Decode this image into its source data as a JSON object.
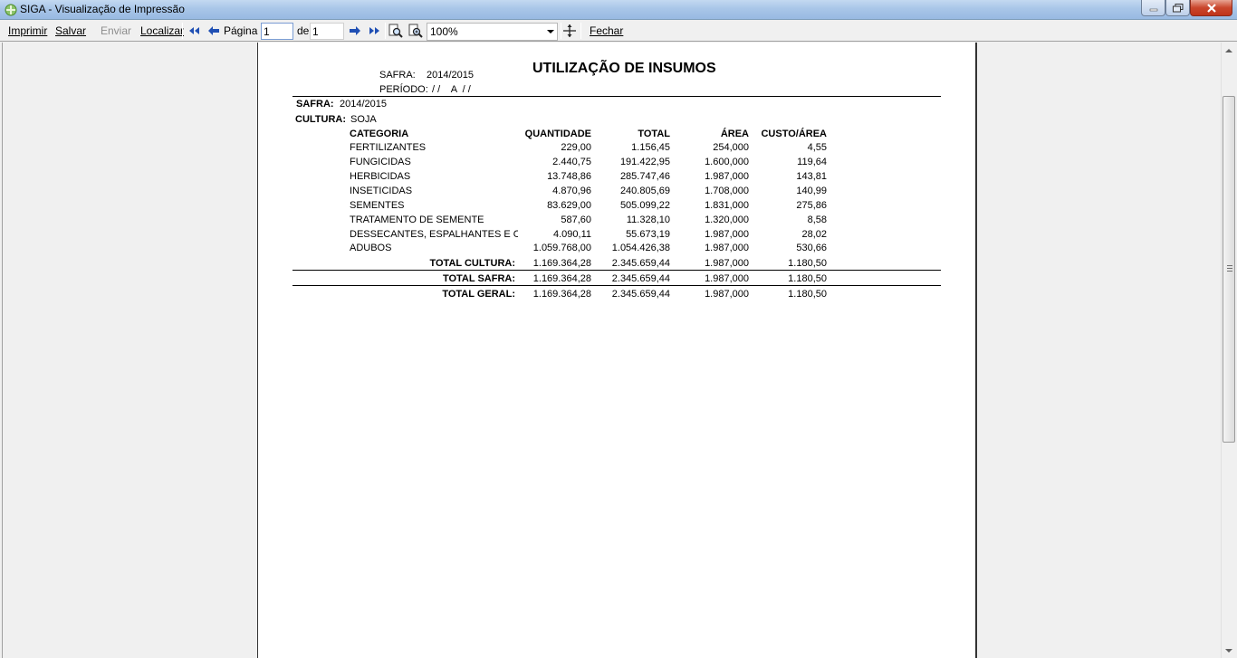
{
  "window": {
    "title": "SIGA - Visualização de Impressão"
  },
  "toolbar": {
    "imprimir": "Imprimir",
    "salvar": "Salvar",
    "enviar": "Enviar",
    "localizar": "Localizar",
    "pagina_label": "Página",
    "pagina_value": "1",
    "de_label": "de",
    "total_pages": "1",
    "zoom_value": "100%",
    "fechar": "Fechar"
  },
  "report": {
    "title": "UTILIZAÇÃO DE INSUMOS",
    "header_safra_label": "SAFRA:",
    "header_safra_value": "2014/2015",
    "header_periodo_label": "PERÍODO:",
    "header_periodo_value": "/ /    A  / /",
    "safra_label": "SAFRA:",
    "safra_value": "2014/2015",
    "cultura_label": "CULTURA:",
    "cultura_value": "SOJA",
    "columns": [
      "CATEGORIA",
      "QUANTIDADE",
      "TOTAL",
      "ÁREA",
      "CUSTO/ÁREA"
    ],
    "rows": [
      {
        "categoria": "FERTILIZANTES",
        "quantidade": "229,00",
        "total": "1.156,45",
        "area": "254,000",
        "custo": "4,55"
      },
      {
        "categoria": "FUNGICIDAS",
        "quantidade": "2.440,75",
        "total": "191.422,95",
        "area": "1.600,000",
        "custo": "119,64"
      },
      {
        "categoria": "HERBICIDAS",
        "quantidade": "13.748,86",
        "total": "285.747,46",
        "area": "1.987,000",
        "custo": "143,81"
      },
      {
        "categoria": "INSETICIDAS",
        "quantidade": "4.870,96",
        "total": "240.805,69",
        "area": "1.708,000",
        "custo": "140,99"
      },
      {
        "categoria": "SEMENTES",
        "quantidade": "83.629,00",
        "total": "505.099,22",
        "area": "1.831,000",
        "custo": "275,86"
      },
      {
        "categoria": "TRATAMENTO DE SEMENTE",
        "quantidade": "587,60",
        "total": "11.328,10",
        "area": "1.320,000",
        "custo": "8,58"
      },
      {
        "categoria": "DESSECANTES, ESPALHANTES E OUT",
        "quantidade": "4.090,11",
        "total": "55.673,19",
        "area": "1.987,000",
        "custo": "28,02"
      },
      {
        "categoria": "ADUBOS",
        "quantidade": "1.059.768,00",
        "total": "1.054.426,38",
        "area": "1.987,000",
        "custo": "530,66"
      }
    ],
    "totals": [
      {
        "label": "TOTAL CULTURA:",
        "quantidade": "1.169.364,28",
        "total": "2.345.659,44",
        "area": "1.987,000",
        "custo": "1.180,50"
      },
      {
        "label": "TOTAL SAFRA:",
        "quantidade": "1.169.364,28",
        "total": "2.345.659,44",
        "area": "1.987,000",
        "custo": "1.180,50"
      },
      {
        "label": "TOTAL GERAL:",
        "quantidade": "1.169.364,28",
        "total": "2.345.659,44",
        "area": "1.987,000",
        "custo": "1.180,50"
      }
    ]
  }
}
